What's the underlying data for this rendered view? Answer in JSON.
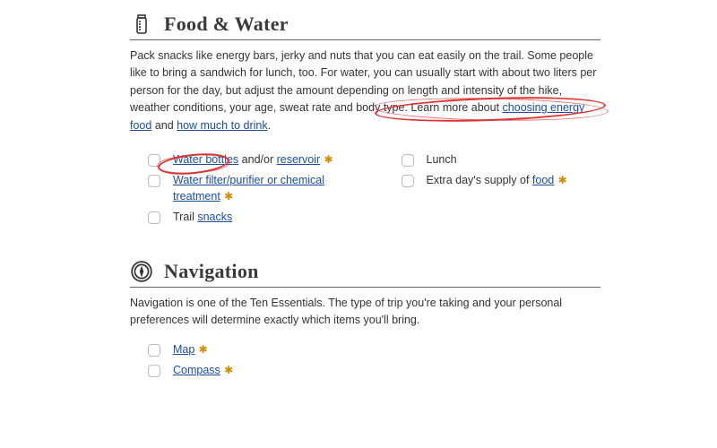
{
  "food": {
    "title": "Food & Water",
    "blurb": {
      "t1": "Pack snacks like energy bars, jerky and nuts that you can eat easily on the trail. Some people like to bring a sandwich for lunch, too. For water, you can usually start with about two liters per person for the day, but adjust the amount depending on length and intensity of the hike, weather conditions, your age, sweat rate and body type. Learn more about ",
      "link1": "choosing energy food",
      "t2": " and ",
      "link2": "how much to drink",
      "t3": "."
    },
    "items": {
      "water_bottles_link": "Water bottles",
      "water_bottles_mid": " and/or ",
      "reservoir_link": "reservoir",
      "filter_link": "Water filter/purifier or chemical treatment",
      "snacks_pre": "Trail ",
      "snacks_link": "snacks",
      "lunch": "Lunch",
      "extra_pre": "Extra day's supply of ",
      "extra_link": "food"
    }
  },
  "nav": {
    "title": "Navigation",
    "blurb": "Navigation is one of the Ten Essentials. The type of trip you're taking and your personal preferences will determine exactly which items you'll bring.",
    "items": {
      "map": "Map",
      "compass": "Compass"
    }
  }
}
